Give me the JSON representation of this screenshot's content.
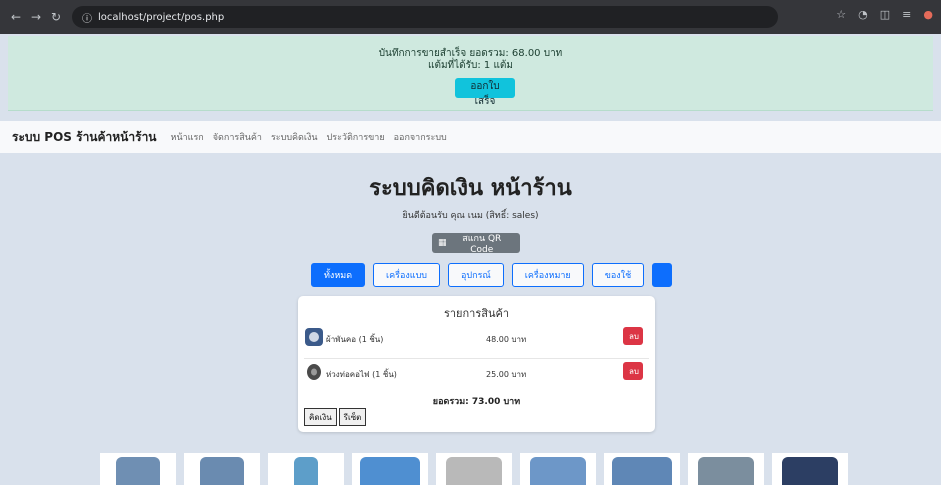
{
  "browser": {
    "url": "localhost/project/pos.php",
    "icons": [
      "back-icon",
      "forward-icon",
      "reload-icon",
      "site-info-icon",
      "star-icon",
      "extension-icon",
      "puzzle-icon",
      "menu-icon",
      "profile-icon"
    ]
  },
  "alert": {
    "line1": "บันทึกการขายสำเร็จ ยอดรวม: 68.00 บาท",
    "line2": "แต้มที่ได้รับ: 1 แต้ม",
    "button": "ออกใบเสร็จ",
    "color": "#cfe9df"
  },
  "nav": {
    "brand": "ระบบ POS ร้านค้าหน้าร้าน",
    "links": [
      "หน้าแรก",
      "จัดการสินค้า",
      "ระบบคิดเงิน",
      "ประวัติการขาย",
      "ออกจากระบบ"
    ]
  },
  "page": {
    "title": "ระบบคิดเงิน หน้าร้าน",
    "welcome": "ยินดีต้อนรับ คุณ เนม (สิทธิ์: sales)",
    "qr_button": "สแกน QR Code"
  },
  "categories": [
    "ทั้งหมด",
    "เครื่องแบบ",
    "อุปกรณ์",
    "เครื่องหมาย",
    "ของใช้"
  ],
  "cart": {
    "title": "รายการสินค้า",
    "items": [
      {
        "name": "ผ้าพันคอ (1 ชิ้น)",
        "price": "48.00 บาท",
        "delete": "ลบ"
      },
      {
        "name": "ห่วงท่อคอไฟ (1 ชิ้น)",
        "price": "25.00 บาท",
        "delete": "ลบ"
      }
    ],
    "total": "ยอดรวม: 73.00 บาท",
    "checkout": "คิดเงิน",
    "reset": "รีเซ็ต"
  },
  "colors": {
    "primary": "#0d6efd",
    "danger": "#dc3545",
    "info": "#11c3dc"
  }
}
